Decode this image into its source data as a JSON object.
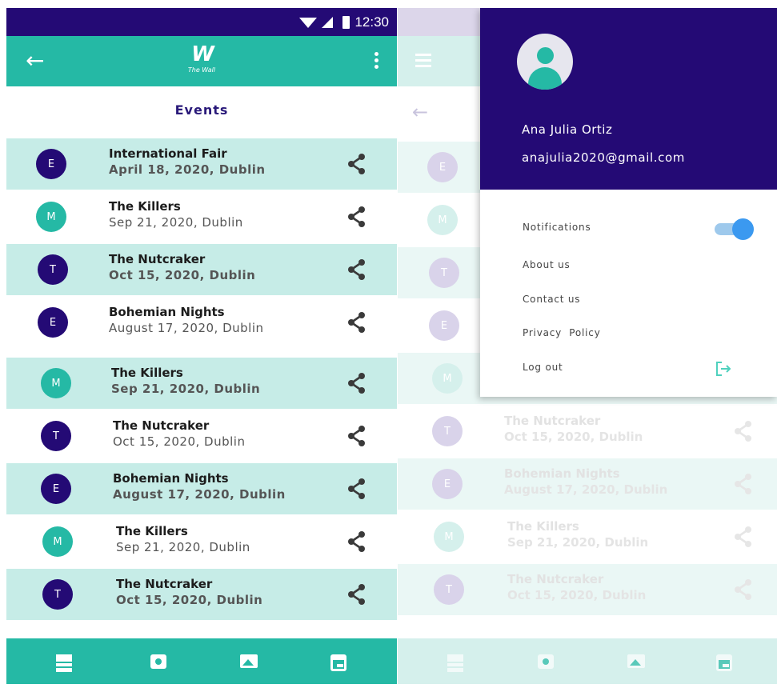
{
  "status_bar": {
    "time": "12:30"
  },
  "app_bar": {
    "logo_mark": "W",
    "logo_text": "The Wall"
  },
  "page_title": "Events",
  "events": [
    {
      "initial": "E",
      "name": "International Fair",
      "date": "April 18, 2020, Dublin",
      "tinted": true
    },
    {
      "initial": "M",
      "name": "The Killers",
      "date": "Sep 21, 2020, Dublin",
      "tinted": false
    },
    {
      "initial": "T",
      "name": "The Nutcraker",
      "date": "Oct 15, 2020, Dublin",
      "tinted": true
    },
    {
      "initial": "E",
      "name": "Bohemian Nights",
      "date": "August 17, 2020, Dublin",
      "tinted": false
    },
    {
      "initial": "M",
      "name": "The Killers",
      "date": "Sep 21, 2020, Dublin",
      "tinted": true
    },
    {
      "initial": "T",
      "name": "The Nutcraker",
      "date": "Oct 15, 2020, Dublin",
      "tinted": false
    },
    {
      "initial": "E",
      "name": "Bohemian Nights",
      "date": "August 17, 2020, Dublin",
      "tinted": true
    },
    {
      "initial": "M",
      "name": "The Killers",
      "date": "Sep 21, 2020, Dublin",
      "tinted": false
    },
    {
      "initial": "T",
      "name": "The Nutcraker",
      "date": "Oct 15, 2020, Dublin",
      "tinted": true
    }
  ],
  "bottom_nav": [
    {
      "icon": "dashboard-icon"
    },
    {
      "icon": "camera-icon"
    },
    {
      "icon": "image-icon"
    },
    {
      "icon": "calendar-icon"
    }
  ],
  "drawer": {
    "user_name": "Ana Julia Ortiz",
    "user_email": "anajulia2020@gmail.com",
    "items": [
      {
        "label": "Notifications",
        "control": "toggle",
        "on": true
      },
      {
        "label": "About us"
      },
      {
        "label": "Contact us"
      },
      {
        "label": "Privacy  Policy"
      },
      {
        "label": "Log out",
        "icon": "logout-icon"
      }
    ]
  },
  "colors": {
    "primary_dark": "#240a75",
    "teal": "#25b9a5",
    "row_tint": "#c6ece7",
    "avatar_e": "#240a75",
    "avatar_m": "#25b9a5",
    "avatar_t": "#240a75",
    "toggle_on": "#3b99f0"
  }
}
